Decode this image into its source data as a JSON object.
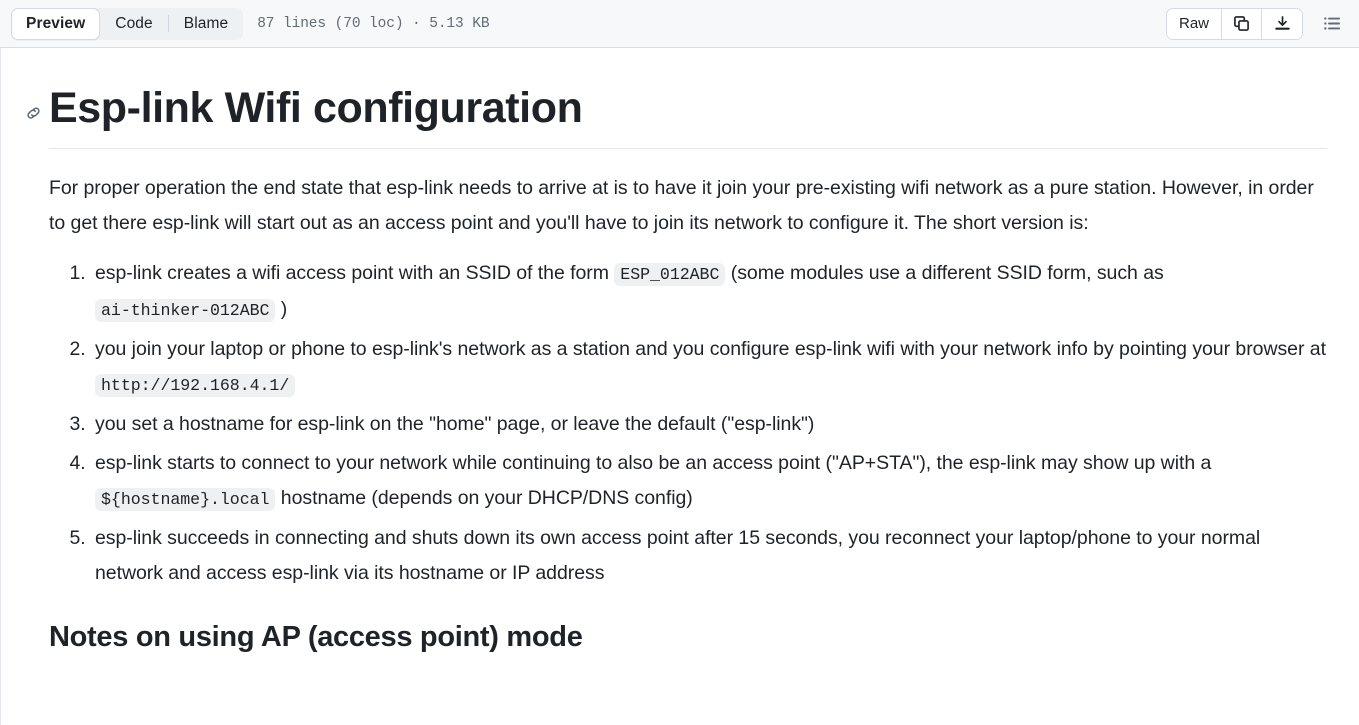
{
  "header": {
    "tabs": [
      {
        "label": "Preview",
        "selected": true
      },
      {
        "label": "Code",
        "selected": false
      },
      {
        "label": "Blame",
        "selected": false
      }
    ],
    "file_meta": "87 lines (70 loc) · 5.13 KB",
    "raw_label": "Raw",
    "copy_icon": "copy-icon",
    "download_icon": "download-icon",
    "outline_icon": "outline-list-icon"
  },
  "document": {
    "heading": "Esp-link Wifi configuration",
    "anchor_icon": "link-icon",
    "intro": "For proper operation the end state that esp-link needs to arrive at is to have it join your pre-existing wifi network as a pure station. However, in order to get there esp-link will start out as an access point and you'll have to join its network to configure it. The short version is:",
    "steps": [
      {
        "parts": [
          {
            "type": "text",
            "value": "esp-link creates a wifi access point with an SSID of the form "
          },
          {
            "type": "code",
            "value": "ESP_012ABC"
          },
          {
            "type": "text",
            "value": " (some modules use a different SSID form, such as "
          },
          {
            "type": "code",
            "value": "ai-thinker-012ABC"
          },
          {
            "type": "text",
            "value": " )"
          }
        ]
      },
      {
        "parts": [
          {
            "type": "text",
            "value": "you join your laptop or phone to esp-link's network as a station and you configure esp-link wifi with your network info by pointing your browser at "
          },
          {
            "type": "code",
            "value": "http://192.168.4.1/"
          }
        ]
      },
      {
        "parts": [
          {
            "type": "text",
            "value": "you set a hostname for esp-link on the \"home\" page, or leave the default (\"esp-link\")"
          }
        ]
      },
      {
        "parts": [
          {
            "type": "text",
            "value": "esp-link starts to connect to your network while continuing to also be an access point (\"AP+STA\"), the esp-link may show up with a "
          },
          {
            "type": "code",
            "value": "${hostname}.local"
          },
          {
            "type": "text",
            "value": " hostname (depends on your DHCP/DNS config)"
          }
        ]
      },
      {
        "parts": [
          {
            "type": "text",
            "value": "esp-link succeeds in connecting and shuts down its own access point after 15 seconds, you reconnect your laptop/phone to your normal network and access esp-link via its hostname or IP address"
          }
        ]
      }
    ],
    "section_heading": "Notes on using AP (access point) mode"
  },
  "colors": {
    "header_bg": "#f6f8fa",
    "border": "#d8dee4",
    "text": "#1f2328",
    "muted": "#636c76",
    "code_bg": "#eef0f2"
  }
}
